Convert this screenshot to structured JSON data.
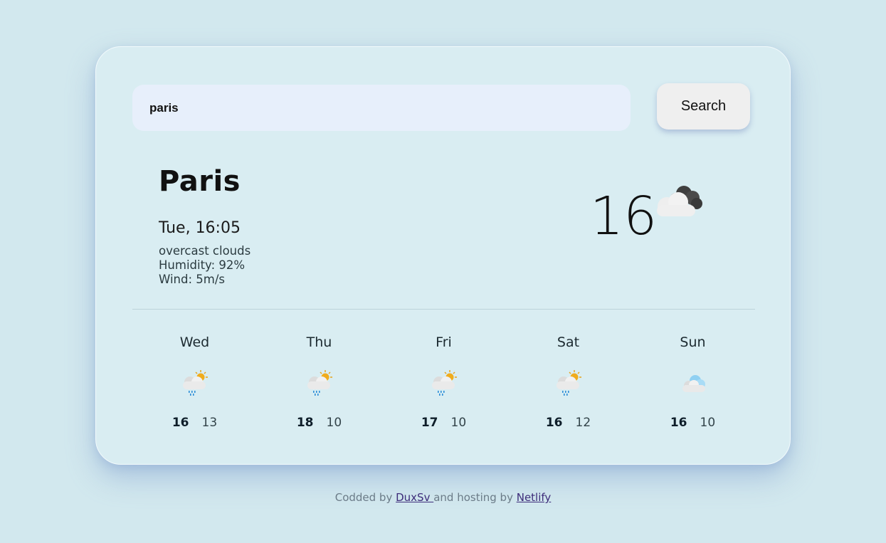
{
  "search": {
    "value": "paris",
    "button_label": "Search"
  },
  "current": {
    "city": "Paris",
    "datetime": "Tue, 16:05",
    "description": "overcast clouds",
    "humidity": "Humidity: 92%",
    "wind": "Wind: 5m/s",
    "temp": "16",
    "icon": "overcast-clouds-icon"
  },
  "forecast": [
    {
      "day": "Wed",
      "hi": "16",
      "lo": "13",
      "icon": "rain-sun-icon"
    },
    {
      "day": "Thu",
      "hi": "18",
      "lo": "10",
      "icon": "rain-sun-icon"
    },
    {
      "day": "Fri",
      "hi": "17",
      "lo": "10",
      "icon": "rain-sun-icon"
    },
    {
      "day": "Sat",
      "hi": "16",
      "lo": "12",
      "icon": "rain-sun-icon"
    },
    {
      "day": "Sun",
      "hi": "16",
      "lo": "10",
      "icon": "partly-cloudy-icon"
    }
  ],
  "footer": {
    "prefix": "Codded by ",
    "author_link": "DuxSv ",
    "middle": "and hosting by ",
    "host_link": "Netlify"
  }
}
